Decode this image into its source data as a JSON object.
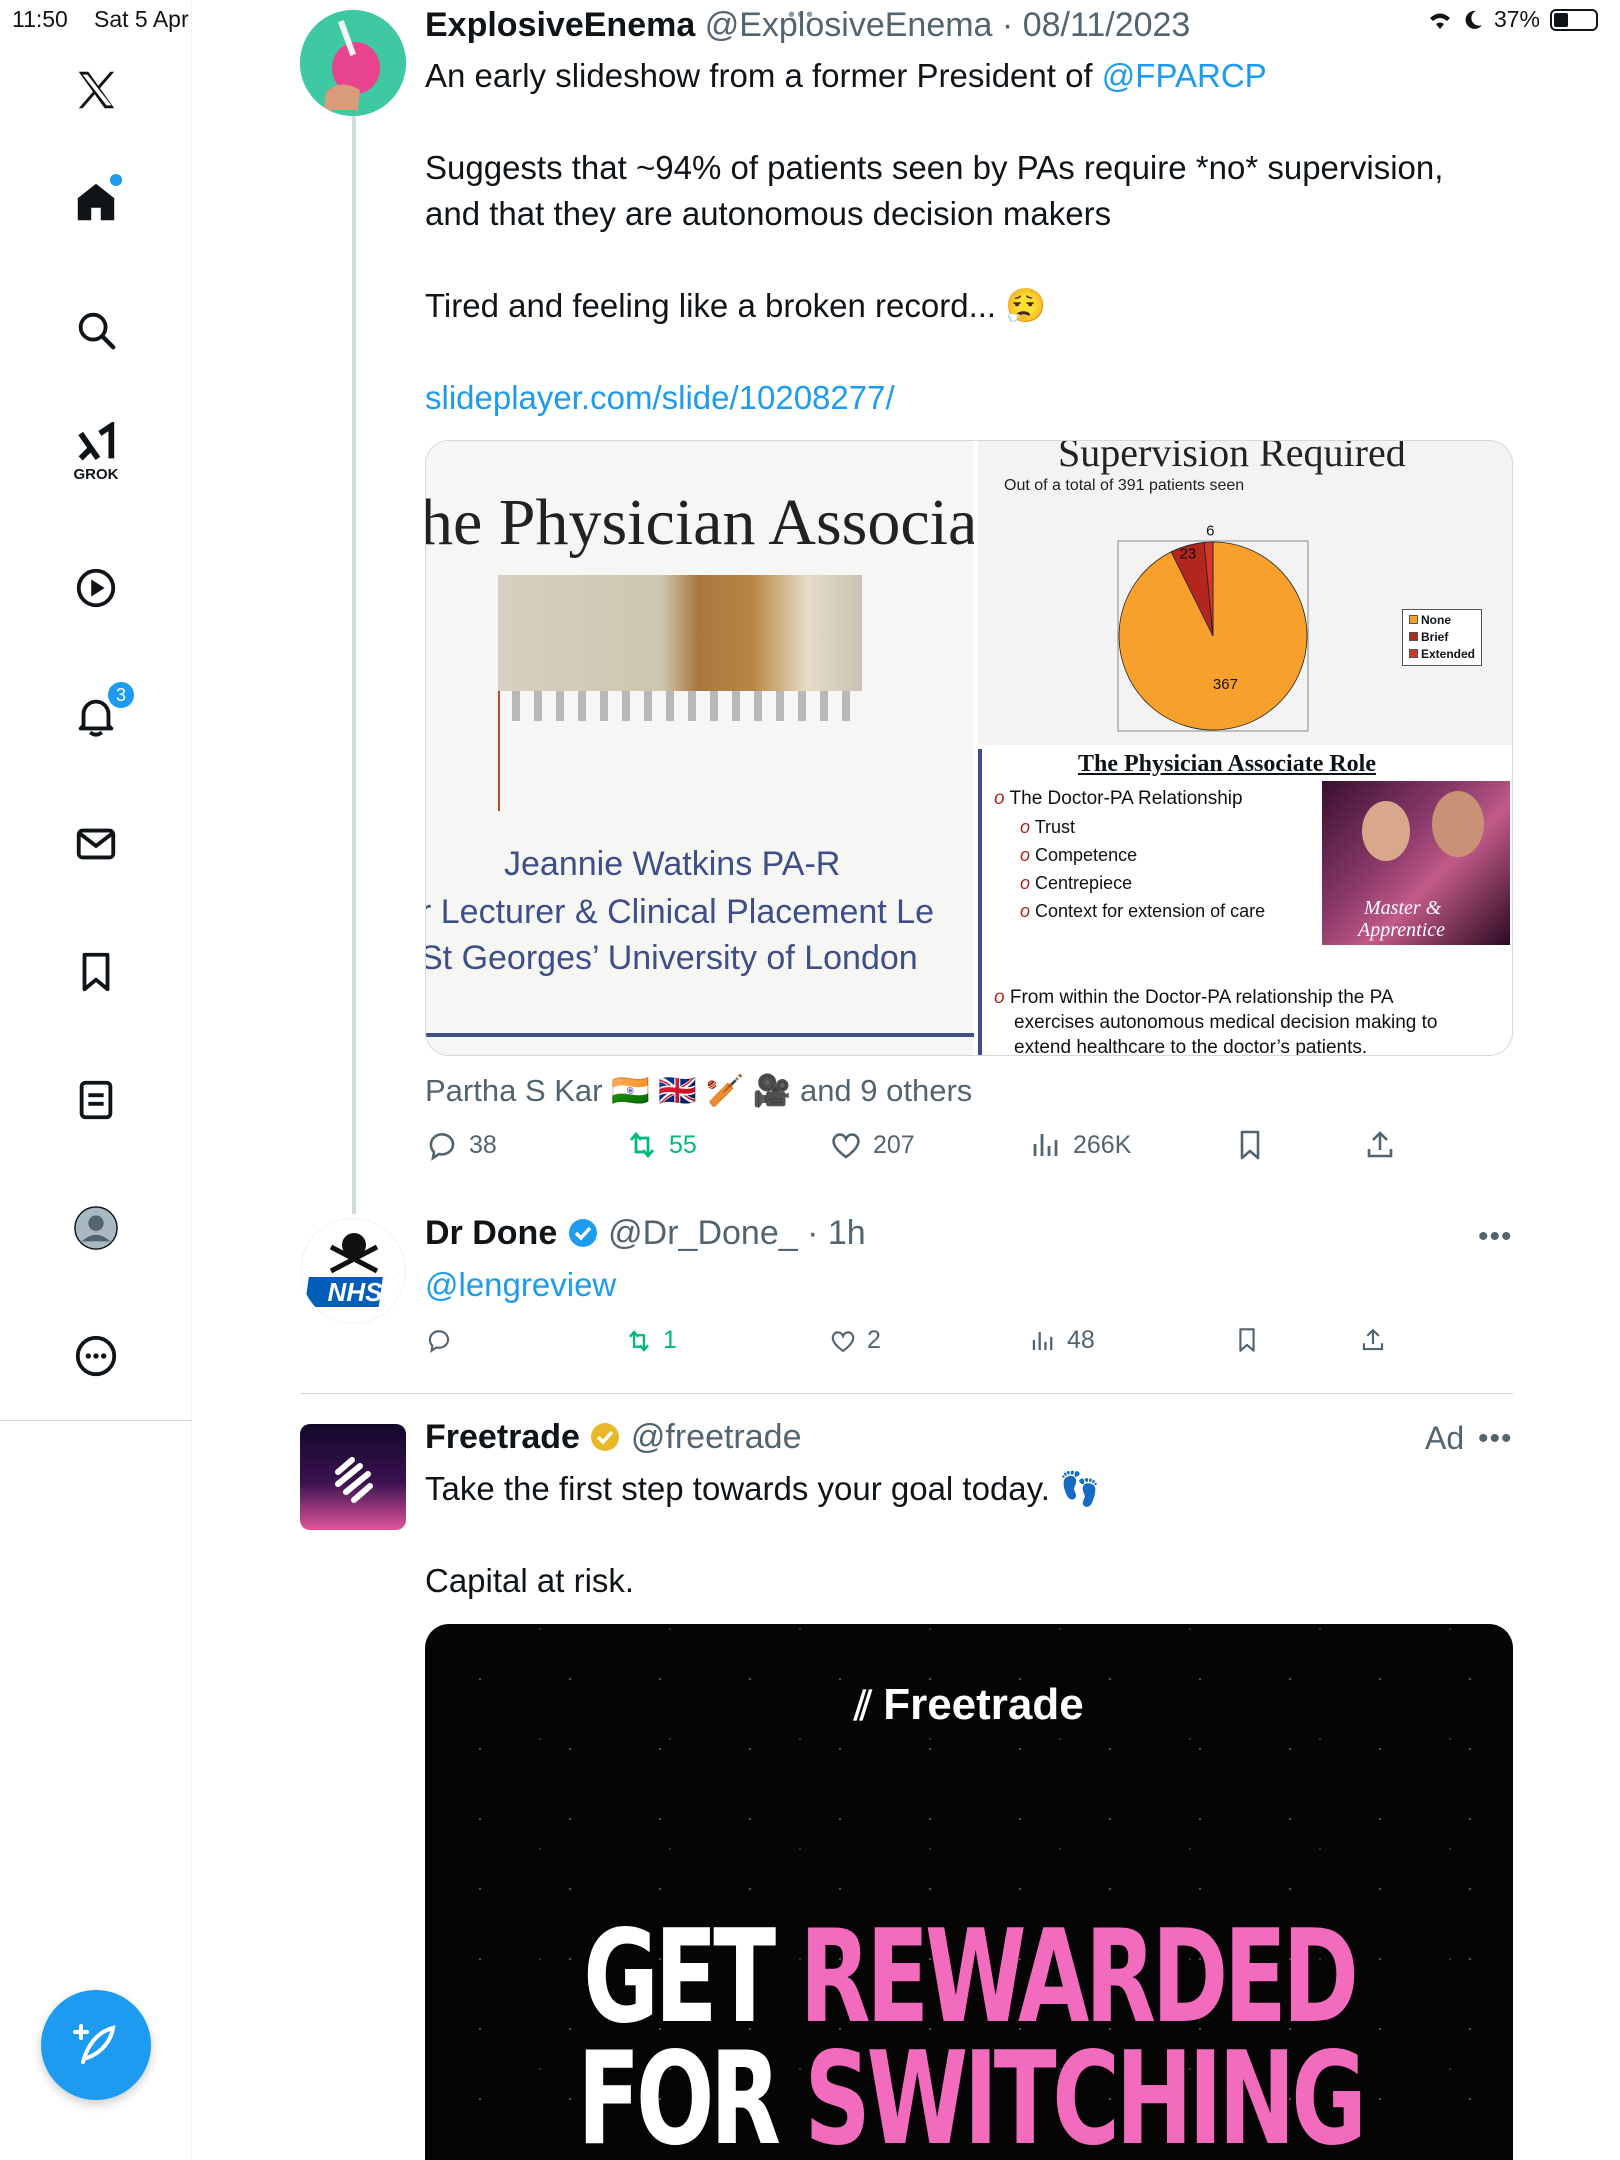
{
  "status_bar": {
    "time": "11:50",
    "date": "Sat 5 Apr",
    "battery": "37%"
  },
  "sidebar": {
    "grok_label": "GROK",
    "notifications_count": "3"
  },
  "tweet1": {
    "name": "ExplosiveEnema",
    "handle": "@ExplosiveEnema",
    "separator": "·",
    "date": "08/11/2023",
    "line1_prefix": "An early slideshow from a former President of ",
    "line1_mention": "@FPARCP",
    "line2": "Suggests that ~94% of patients seen by PAs require *no* supervision,",
    "line3": "and that they are autonomous decision makers",
    "line4": "Tired and feeling like a broken record... 😮‍💨",
    "link": "slideplayer.com/slide/10208277/",
    "slide1": {
      "title": "he Physician Associa",
      "author": "Jeannie Watkins PA-R",
      "role": "r Lecturer & Clinical Placement Le",
      "org": "St Georges’ University of London"
    },
    "slide2": {
      "title": "Supervision Required",
      "subtitle": "Out of a total of 391 patients seen",
      "legend": [
        "None",
        "Brief",
        "Extended"
      ],
      "labels": [
        "367",
        "23",
        "6"
      ]
    },
    "slide3": {
      "title": "The Physician Associate Role",
      "bullet1": "The Doctor-PA Relationship",
      "sub1": "Trust",
      "sub2": "Competence",
      "sub3": "Centrepiece",
      "sub4": "Context for extension of care",
      "bullet2a": "From within the Doctor-PA relationship the PA",
      "bullet2b": "exercises autonomous medical decision making to",
      "bullet2c": "extend healthcare to the doctor’s patients.",
      "poster_line1": "Master &",
      "poster_line2": "Apprentice"
    },
    "liked_by": "Partha S Kar 🇮🇳 🇬🇧 🏏 🎥",
    "liked_others": "and 9 others",
    "replies": "38",
    "reposts": "55",
    "likes": "207",
    "views": "266K"
  },
  "tweet2": {
    "name": "Dr Done",
    "handle": "@Dr_Done_",
    "separator": "·",
    "time": "1h",
    "text": "@lengreview",
    "reposts": "1",
    "likes": "2",
    "views": "48",
    "avatar_text": "NHS"
  },
  "tweet3": {
    "name": "Freetrade",
    "handle": "@freetrade",
    "ad_label": "Ad",
    "text1": "Take the first step towards your goal today. 👣",
    "text2": "Capital at risk.",
    "video_brand": "Freetrade",
    "video_line1a": "GET",
    "video_line1b": "REWARDED",
    "video_line2a": "FOR",
    "video_line2b": "SWITCHING"
  },
  "chart_data": {
    "type": "pie",
    "title": "Supervision Required",
    "subtitle": "Out of a total of 391 patients seen",
    "categories": [
      "None",
      "Brief",
      "Extended"
    ],
    "values": [
      367,
      23,
      6
    ],
    "colors": [
      "#f7a12c",
      "#b3261e",
      "#d9342b"
    ],
    "legend_position": "right"
  }
}
